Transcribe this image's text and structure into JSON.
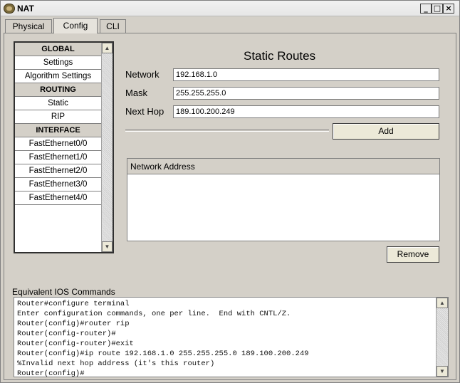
{
  "window": {
    "title": "NAT"
  },
  "tabs": [
    "Physical",
    "Config",
    "CLI"
  ],
  "nav": {
    "items": [
      {
        "label": "GLOBAL",
        "header": true
      },
      {
        "label": "Settings",
        "header": false
      },
      {
        "label": "Algorithm Settings",
        "header": false
      },
      {
        "label": "ROUTING",
        "header": true
      },
      {
        "label": "Static",
        "header": false
      },
      {
        "label": "RIP",
        "header": false
      },
      {
        "label": "INTERFACE",
        "header": true
      },
      {
        "label": "FastEthernet0/0",
        "header": false
      },
      {
        "label": "FastEthernet1/0",
        "header": false
      },
      {
        "label": "FastEthernet2/0",
        "header": false
      },
      {
        "label": "FastEthernet3/0",
        "header": false
      },
      {
        "label": "FastEthernet4/0",
        "header": false
      }
    ]
  },
  "static_routes": {
    "heading": "Static Routes",
    "network_label": "Network",
    "network_value": "192.168.1.0",
    "mask_label": "Mask",
    "mask_value": "255.255.255.0",
    "nexthop_label": "Next Hop",
    "nexthop_value": "189.100.200.249",
    "add_label": "Add",
    "table_header": "Network Address",
    "remove_label": "Remove"
  },
  "ios": {
    "label": "Equivalent IOS Commands",
    "lines": [
      "Router#configure terminal",
      "Enter configuration commands, one per line.  End with CNTL/Z.",
      "Router(config)#router rip",
      "Router(config-router)#",
      "Router(config-router)#exit",
      "Router(config)#ip route 192.168.1.0 255.255.255.0 189.100.200.249",
      "%Invalid next hop address (it's this router)",
      "Router(config)#"
    ]
  }
}
